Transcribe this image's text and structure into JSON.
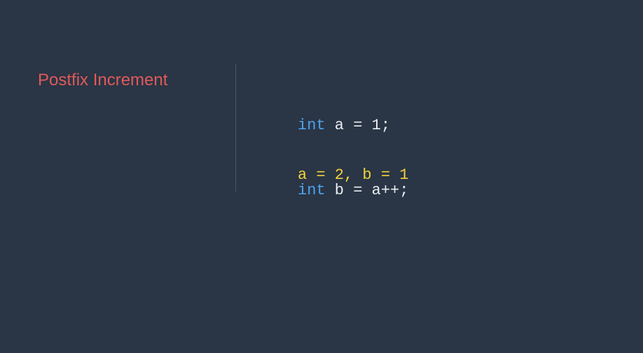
{
  "slide": {
    "title": "Postfix Increment",
    "code": [
      {
        "keyword": "int",
        "rest": " a = 1;"
      },
      {
        "keyword": "int",
        "rest": " b = a++;"
      }
    ],
    "result": "a = 2, b = 1"
  },
  "colors": {
    "background": "#2a3545",
    "title": "#e05a5a",
    "keyword": "#4da3f0",
    "code_text": "#e8ecf0",
    "result": "#f0d23a",
    "divider": "#4a5566"
  }
}
